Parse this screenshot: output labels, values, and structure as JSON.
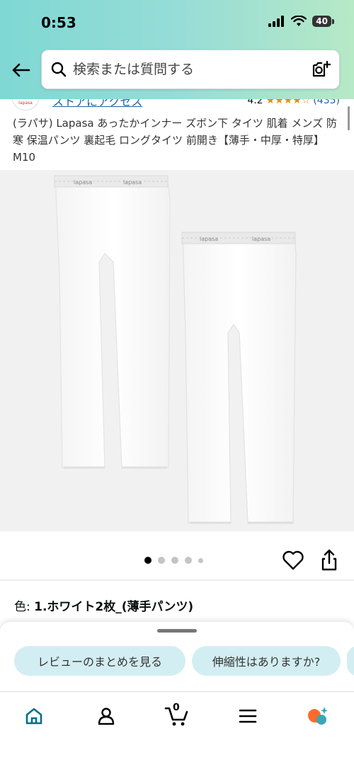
{
  "status_bar": {
    "time": "0:53",
    "battery": "40"
  },
  "search": {
    "placeholder": "検索または質問する"
  },
  "store": {
    "logo_text": "lapasa",
    "link": "ストアにアクセス",
    "rating": "4.2",
    "stars": "★★★★☆",
    "review_count": "(435)"
  },
  "product": {
    "title": "(ラパサ) Lapasa あったかインナー ズボン下 タイツ 肌着 メンズ 防寒 保温パンツ 裏起毛 ロングタイツ 前開き【薄手・中厚・特厚】M10",
    "waistband_text": "lapasa",
    "image_count": 5,
    "active_image": 1
  },
  "variation": {
    "label": "色:",
    "value": "1.ホワイト2枚_(薄手パンツ)"
  },
  "suggestions": [
    "レビューのまとめを見る",
    "伸縮性はありますか?"
  ],
  "cart": {
    "count": "0"
  },
  "colors": {
    "accent": "#007185",
    "link": "#2162a1",
    "star": "#e88b00",
    "chip_bg": "#d3eef2"
  },
  "icons": [
    "back-arrow-icon",
    "search-icon",
    "camera-icon",
    "heart-icon",
    "share-icon",
    "home-icon",
    "profile-icon",
    "cart-icon",
    "menu-icon",
    "rufus-icon"
  ]
}
